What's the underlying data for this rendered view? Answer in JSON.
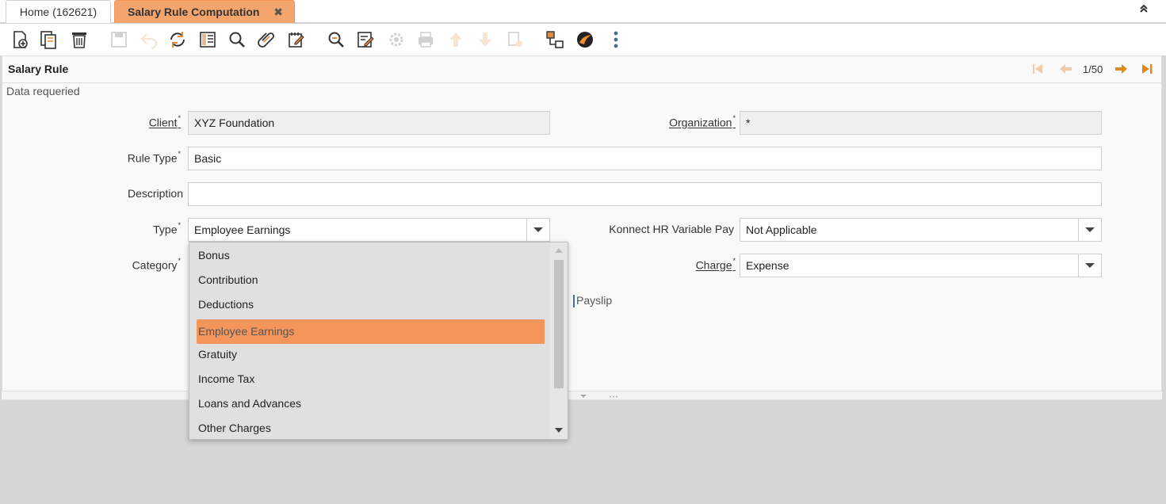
{
  "tabs": [
    {
      "label": "Home (162621)"
    },
    {
      "label": "Salary Rule Computation",
      "close": "✖"
    }
  ],
  "collapse_icon": "double-chevron-up-icon",
  "toolbar": {
    "icons": [
      "new-record-icon",
      "copy-record-icon",
      "delete-icon",
      "save-icon",
      "undo-icon",
      "refresh-icon",
      "grid-toggle-icon",
      "find-icon",
      "attachment-icon",
      "note-icon",
      "zoom-icon",
      "report-icon",
      "process-icon",
      "print-icon",
      "up-icon",
      "down-icon",
      "archive-icon",
      "workflow-icon",
      "product-info-icon",
      "more-icon"
    ]
  },
  "window": {
    "title": "Salary Rule",
    "status": "Data requeried",
    "nav": {
      "position": "1/50"
    }
  },
  "form": {
    "client": {
      "label": "Client",
      "value": "XYZ Foundation"
    },
    "organization": {
      "label": "Organization",
      "value": "*"
    },
    "rule_type": {
      "label": "Rule Type",
      "value": "Basic"
    },
    "description": {
      "label": "Description",
      "value": ""
    },
    "type": {
      "label": "Type",
      "value": "Employee Earnings"
    },
    "variable_pay": {
      "label": "Konnect HR Variable Pay",
      "value": "Not Applicable"
    },
    "category": {
      "label": "Category"
    },
    "charge": {
      "label": "Charge",
      "value": "Expense"
    },
    "payslip": {
      "label": "Payslip"
    },
    "required_mark": "*"
  },
  "dropdown": {
    "options": [
      "Bonus",
      "Contribution",
      "Deductions",
      "Employee Earnings",
      "Gratuity",
      "Income Tax",
      "Loans and Advances",
      "Other Charges"
    ],
    "selected": "Employee Earnings"
  },
  "colors": {
    "accent": "#f4a46d",
    "selected": "#f4955b"
  }
}
